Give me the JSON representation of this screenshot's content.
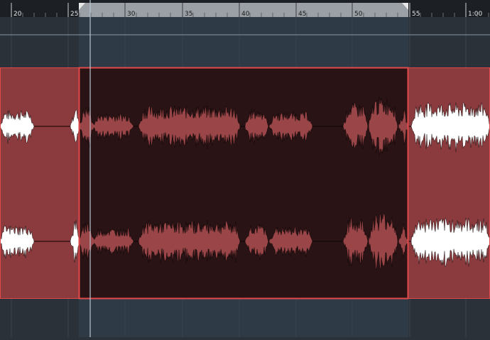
{
  "ruler": {
    "labels": [
      "20",
      "25",
      "30",
      "35",
      "40",
      "45",
      "50",
      "55",
      "1:00"
    ]
  },
  "colors": {
    "ruler_bg": "#1c1f24",
    "ruler_loop": "#9aa0a6",
    "lane_bg": "#2b3139",
    "lane_loop_bg": "#2f3a47",
    "clip": "#8b3a3d",
    "clip_selected": "#2a1314",
    "clip_border": "#e04a4a",
    "waveform": "#ffffff",
    "waveform_selected": "#9a4548",
    "playhead": "#b8c4d0",
    "cycle_marker": "#e8e8e8"
  },
  "selection_state": "selected-range"
}
